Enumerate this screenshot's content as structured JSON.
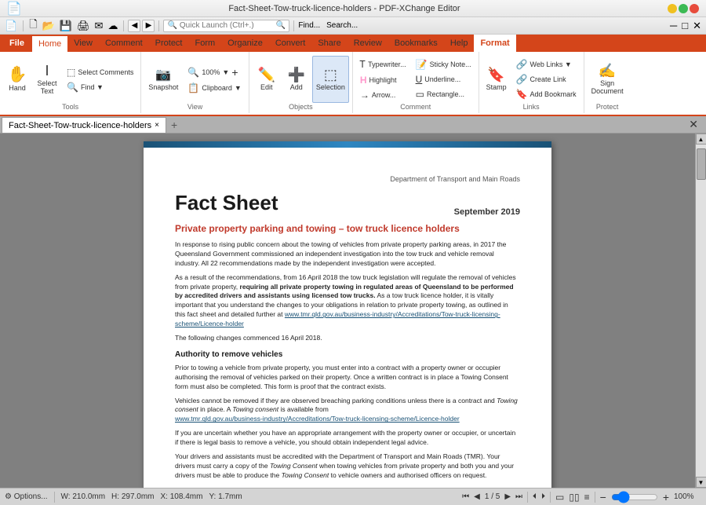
{
  "titlebar": {
    "text": "Fact-Sheet-Tow-truck-licence-holders - PDF-XChange Editor",
    "tool": "Hand Tool"
  },
  "menu": {
    "file": "File",
    "items": [
      "Home",
      "View",
      "Comment",
      "Protect",
      "Form",
      "Organize",
      "Convert",
      "Share",
      "Review",
      "Bookmarks",
      "Help",
      "Format"
    ]
  },
  "toolbar": {
    "nav_back": "◀",
    "nav_fwd": "▶",
    "zoom_level": "100%",
    "zoom_plus": "+",
    "hand_label": "Hand",
    "select_text_label": "Select\nText",
    "select_comments_label": "Select\nComments",
    "find_label": "Find",
    "snapshot_label": "Snapshot",
    "clipboard_label": "Clipboard",
    "view_label": "View",
    "edit_label": "Edit",
    "add_label": "Add",
    "selection_label": "Selection",
    "objects_label": "Objects",
    "typewriter_label": "Typewriter...",
    "highlight_label": "Highlight",
    "arrow_label": "Arrow...",
    "underline_label": "Underline...",
    "sticky_label": "Sticky Note...",
    "rectangle_label": "Rectangle...",
    "comment_label": "Comment",
    "stamp_label": "Stamp",
    "web_links_label": "Web Links ▼",
    "create_link_label": "Create Link",
    "add_bookmark_label": "Add Bookmark",
    "links_label": "Links",
    "sign_document_label": "Sign\nDocument",
    "protect_label": "Protect",
    "find_btn": "Find...",
    "find2_btn": "Search..."
  },
  "doc_tab": {
    "filename": "Fact-Sheet-Tow-truck-licence-holders",
    "close": "×",
    "add": "+"
  },
  "pdf": {
    "dept_label": "Department of Transport and Main Roads",
    "title": "Fact Sheet",
    "date": "September 2019",
    "subtitle": "Private property parking and towing – tow truck licence holders",
    "para1": "In response to rising public concern about the towing of vehicles from private property parking areas, in 2017 the Queensland Government commissioned an independent investigation into the tow truck and vehicle removal industry. All 22 recommendations made by the independent investigation were accepted.",
    "para2": "As a result of the recommendations, from 16 April 2018 the tow truck legislation will regulate the removal of vehicles from private property,",
    "para2b": "requiring all private property towing in regulated areas of Queensland to be performed by accredited drivers and assistants using licensed tow trucks.",
    "para2c": "As a tow truck licence holder, it is vitally important that you understand the changes to your obligations in relation to private property towing, as outlined in this fact sheet and detailed further at",
    "para2_link": "www.tmr.qld.gov.au/business-industry/Accreditations/Tow-truck-licensing-scheme/Licence-holder",
    "para3": "The following changes commenced 16 April 2018.",
    "heading1": "Authority to remove vehicles",
    "para4": "Prior to towing a vehicle from private property, you must enter into a contract with a property owner or occupier authorising the removal of vehicles parked on their property. Once a written contract is in place a Towing Consent form must also be completed. This form is proof that the contract exists.",
    "para5": "Vehicles cannot be removed if they are observed breaching parking conditions unless there is a contract and",
    "para5b": "Towing consent",
    "para5c": "in place. A",
    "para5d": "Towing consent",
    "para5e": "is available from",
    "para5_link": "www.tmr.qld.gov.au/business-industry/Accreditations/Tow-truck-licensing-scheme/Licence-holder",
    "para6": "If you are uncertain whether you have an appropriate arrangement with the property owner or occupier, or uncertain if there is legal basis to remove a vehicle, you should obtain independent legal advice.",
    "para7": "Your drivers and assistants must be accredited with the Department of Transport and Main Roads (TMR). Your drivers must carry a copy of the",
    "para7b": "Towing Consent",
    "para7c": "when towing vehicles from private property and both you and your drivers must be able to produce the",
    "para7d": "Towing Consent",
    "para7e": "to vehicle owners and authorised officers on request."
  },
  "statusbar": {
    "options": "⚙ Options...",
    "width": "W: 210.0mm",
    "height": "H: 297.0mm",
    "x": "X: 108.4mm",
    "y": "Y: 1.7mm",
    "page": "1 / 5",
    "zoom": "100%",
    "zoom_out": "−",
    "zoom_in": "+"
  }
}
